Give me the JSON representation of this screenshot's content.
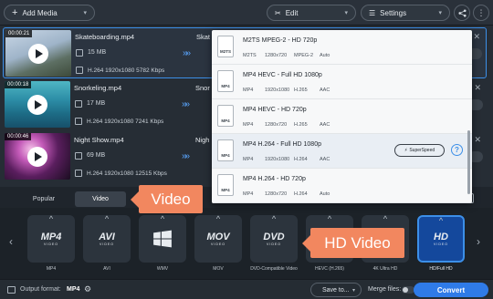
{
  "topbar": {
    "add_media": "Add Media",
    "edit": "Edit",
    "settings": "Settings"
  },
  "files": [
    {
      "time": "00:00:21",
      "name": "Skateboarding.mp4",
      "size": "15 MB",
      "info": "H.264 1920x1080 5782 Kbps",
      "ghost": "Skat"
    },
    {
      "time": "00:00:18",
      "name": "Snorkeling.mp4",
      "size": "17 MB",
      "info": "H.264 1920x1080 7241 Kbps",
      "ghost": "Snor"
    },
    {
      "time": "00:00:46",
      "name": "Night Show.mp4",
      "size": "69 MB",
      "info": "H.264 1920x1080 12515 Kbps",
      "ghost": "Nigh"
    }
  ],
  "dropdown": {
    "items": [
      {
        "icon": "M2TS",
        "title": "M2TS MPEG-2 - HD 720p",
        "specs": [
          "M2TS",
          "1280x720",
          "MPEG-2",
          "Auto"
        ]
      },
      {
        "icon": "MP4",
        "title": "MP4 HEVC - Full HD 1080p",
        "specs": [
          "MP4",
          "1920x1080",
          "H.265",
          "AAC"
        ]
      },
      {
        "icon": "MP4",
        "title": "MP4 HEVC - HD 720p",
        "specs": [
          "MP4",
          "1280x720",
          "H.265",
          "AAC"
        ]
      },
      {
        "icon": "MP4",
        "title": "MP4 H.264 - Full HD 1080p",
        "specs": [
          "MP4",
          "1920x1080",
          "H.264",
          "AAC"
        ],
        "superspeed": "SuperSpeed"
      },
      {
        "icon": "MP4",
        "title": "MP4 H.264 - HD 720p",
        "specs": [
          "MP4",
          "1280x720",
          "H.264",
          "Auto"
        ]
      }
    ]
  },
  "tabs": {
    "popular": "Popular",
    "video": "Video"
  },
  "formats": [
    {
      "big": "MP4",
      "sub": "VIDEO",
      "label": "MP4"
    },
    {
      "big": "AVI",
      "sub": "VIDEO",
      "label": "AVI"
    },
    {
      "big": "",
      "sub": "",
      "label": "WMV"
    },
    {
      "big": "MOV",
      "sub": "VIDEO",
      "label": "MOV"
    },
    {
      "big": "DVD",
      "sub": "VIDEO",
      "label": "DVD-Compatible Video"
    },
    {
      "big": "",
      "sub": "",
      "label": "HEVC (H.265)"
    },
    {
      "big": "",
      "sub": "",
      "label": "4K Ultra HD"
    },
    {
      "big": "HD",
      "sub": "VIDEO",
      "label": "HD/Full HD"
    }
  ],
  "callouts": {
    "video": "Video",
    "hd_video": "HD Video"
  },
  "bottom": {
    "output_label": "Output format:",
    "output_value": "MP4",
    "save_to": "Save to...",
    "merge_files": "Merge files:",
    "convert": "Convert"
  },
  "colors": {
    "accent": "#2f7be8",
    "callout": "#f2875f",
    "selection": "#3c8fe8"
  }
}
